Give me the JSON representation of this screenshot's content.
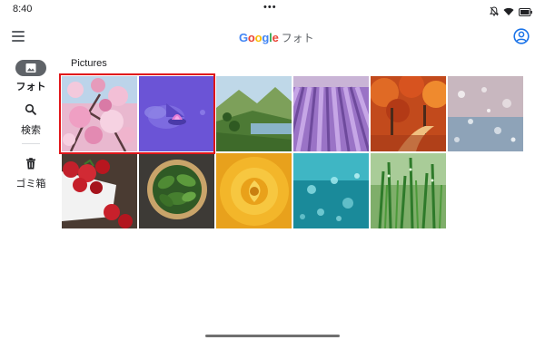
{
  "status_bar": {
    "time": "8:40",
    "dots": "•••",
    "icons": [
      "notifications-off-icon",
      "wifi-icon",
      "battery-icon"
    ]
  },
  "app_bar": {
    "menu_icon": "menu-icon",
    "brand": {
      "letters": [
        {
          "char": "G",
          "color": "#4285F4"
        },
        {
          "char": "o",
          "color": "#EA4335"
        },
        {
          "char": "o",
          "color": "#FBBC05"
        },
        {
          "char": "g",
          "color": "#4285F4"
        },
        {
          "char": "l",
          "color": "#34A853"
        },
        {
          "char": "e",
          "color": "#EA4335"
        }
      ],
      "product": "フォト"
    },
    "account_icon": "account-circle-icon"
  },
  "side_nav": {
    "items": [
      {
        "label": "フォト",
        "icon": "photo-icon",
        "selected": true
      },
      {
        "label": "検索",
        "icon": "search-icon",
        "selected": false
      },
      {
        "label": "ゴミ箱",
        "icon": "trash-icon",
        "selected": false
      }
    ]
  },
  "main": {
    "section_title": "Pictures",
    "photos": [
      {
        "name": "cherry-blossoms",
        "selected": true
      },
      {
        "name": "lotus-on-purple-water",
        "selected": true
      },
      {
        "name": "mountain-lake-valley",
        "selected": false
      },
      {
        "name": "lavender-field",
        "selected": false
      },
      {
        "name": "autumn-forest-path",
        "selected": false
      },
      {
        "name": "bokeh-snow-sparkle",
        "selected": false
      },
      {
        "name": "strawberries-bowl",
        "selected": false
      },
      {
        "name": "basil-leaves-bowl",
        "selected": false
      },
      {
        "name": "yellow-rose",
        "selected": false
      },
      {
        "name": "underwater-bubbles",
        "selected": false
      },
      {
        "name": "green-grass-dew",
        "selected": false
      }
    ]
  },
  "colors": {
    "selection_outline": "#e0161a",
    "accent_blue": "#1a73e8",
    "nav_pill": "#5f6368"
  }
}
